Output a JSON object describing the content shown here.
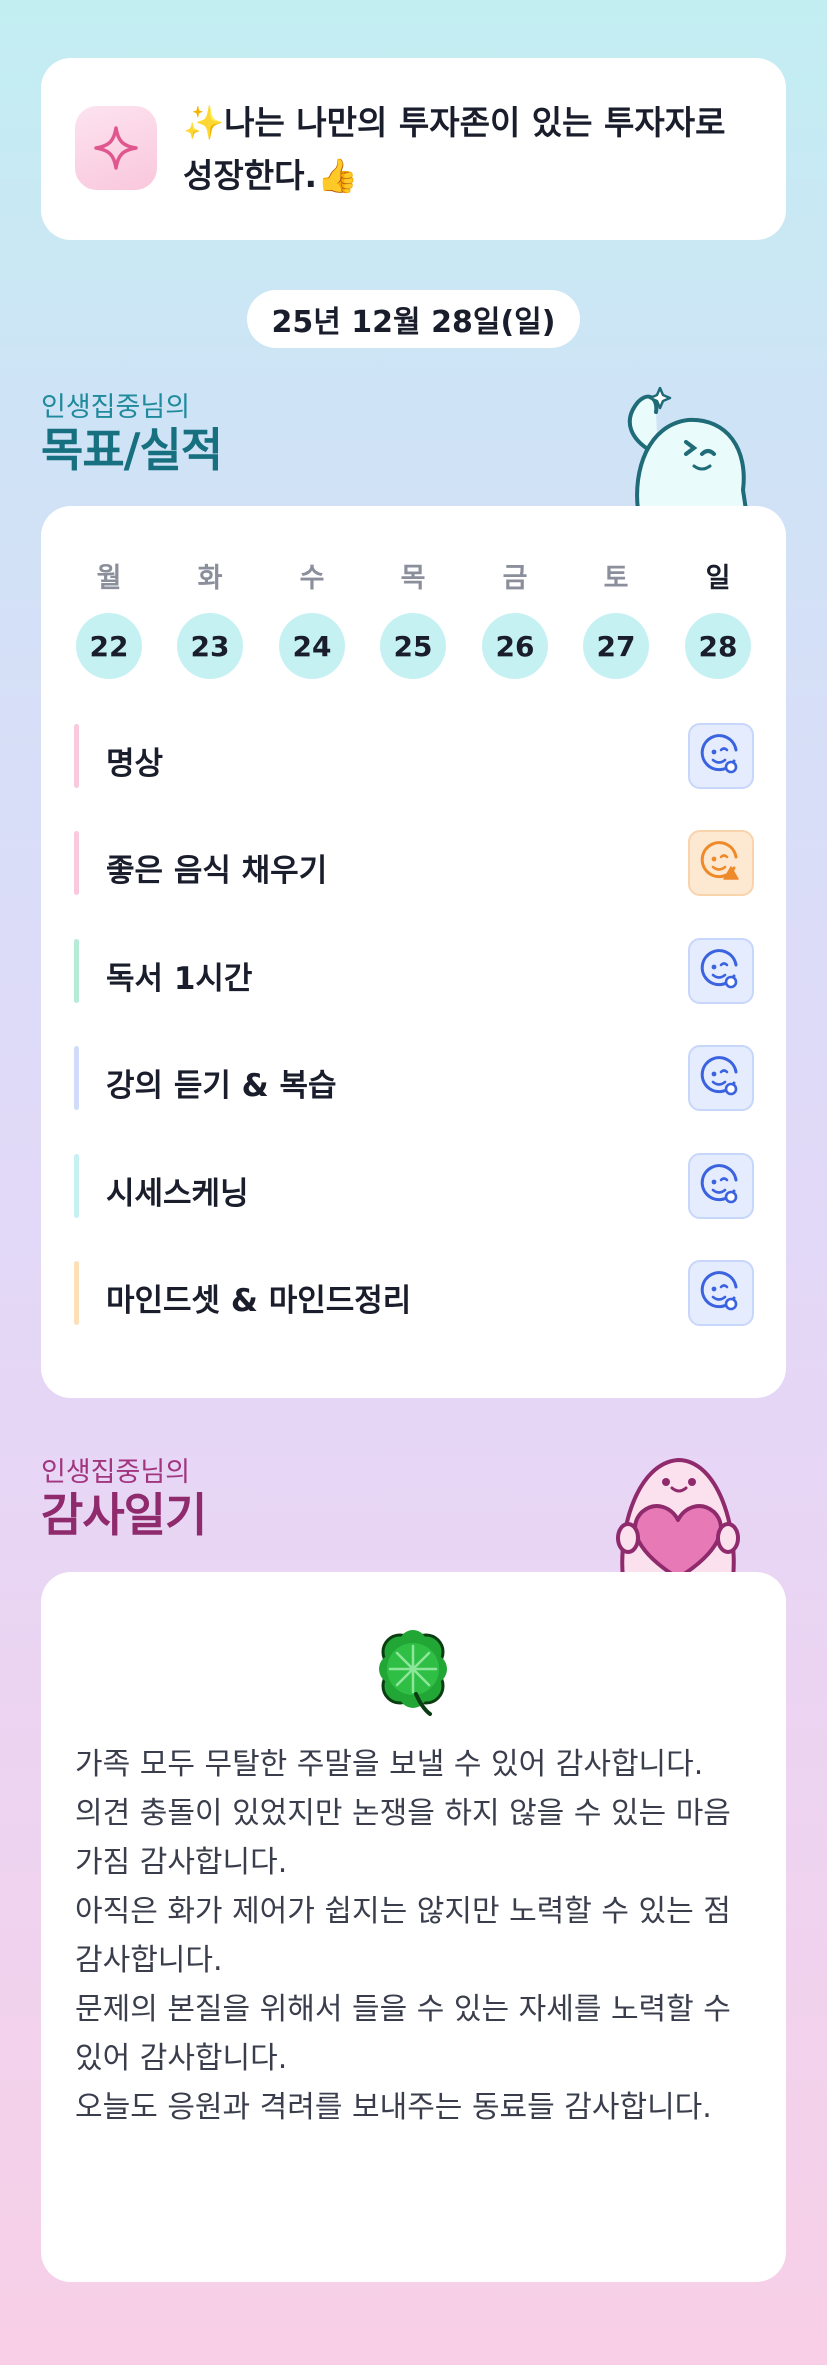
{
  "motto": {
    "icon": "sparkle-icon",
    "text": "✨나는 나만의 투자존이 있는 투자자로 성장한다.👍"
  },
  "date": "25년 12월 28일(일)",
  "goals_section": {
    "subtitle": "인생집중님의",
    "title": "목표/실적",
    "mascot": "waving-mascot"
  },
  "week": {
    "days": [
      {
        "name": "월",
        "date": "22"
      },
      {
        "name": "화",
        "date": "23"
      },
      {
        "name": "수",
        "date": "24"
      },
      {
        "name": "목",
        "date": "25"
      },
      {
        "name": "금",
        "date": "26"
      },
      {
        "name": "토",
        "date": "27"
      },
      {
        "name": "일",
        "date": "28"
      }
    ],
    "selected": "28"
  },
  "goals": [
    {
      "label": "명상",
      "bar_color": "#f9c9de",
      "status": "smile-ok-icon"
    },
    {
      "label": "좋은 음식 채우기",
      "bar_color": "#f9c9de",
      "status": "smile-warning-icon"
    },
    {
      "label": "독서 1시간",
      "bar_color": "#b5ebd7",
      "status": "smile-ok-icon"
    },
    {
      "label": "강의 듣기 & 복습",
      "bar_color": "#d0dcf9",
      "status": "smile-ok-icon"
    },
    {
      "label": "시세스케닝",
      "bar_color": "#c7f0f3",
      "status": "smile-ok-icon"
    },
    {
      "label": "마인드셋 & 마인드정리",
      "bar_color": "#fde0b8",
      "status": "smile-ok-icon"
    }
  ],
  "gratitude_section": {
    "subtitle": "인생집중님의",
    "title": "감사일기",
    "mascot": "heart-mascot"
  },
  "gratitude": {
    "icon": "four-leaf-clover-icon",
    "lines": [
      "가족 모두 무탈한 주말을 보낼 수 있어 감사합니다.",
      "의견 충돌이 있었지만 논쟁을 하지 않을 수 있는 마음 가짐 감사합니다.",
      "아직은 화가 제어가 쉽지는 않지만 노력할 수 있는 점 감사합니다.",
      "문제의 본질을 위해서 들을 수 있는 자세를 노력할 수 있어 감사합니다.",
      "오늘도 응원과 격려를 보내주는 동료들 감사합니다."
    ]
  },
  "colors": {
    "ok_blue": "#3b63e0",
    "warn_orange": "#ef8a2a",
    "goal_title": "#17707f",
    "gratitude_title": "#8f2a6c"
  }
}
